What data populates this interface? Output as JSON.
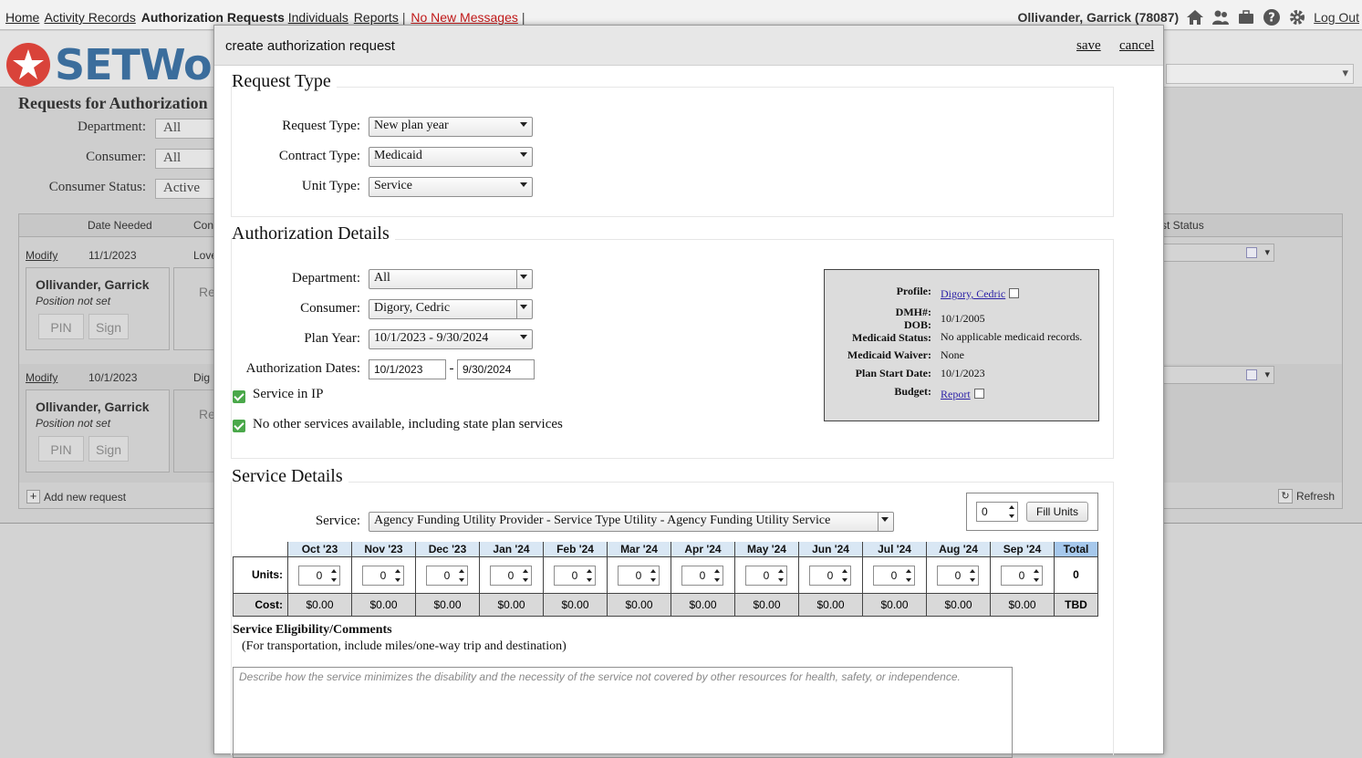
{
  "nav": {
    "links": [
      "Home",
      "Activity Records"
    ],
    "current": "Authorization Requests",
    "links2": [
      "Individuals",
      "Reports"
    ],
    "messages": "No New Messages",
    "user": "Ollivander, Garrick  (78087)",
    "logout": "Log Out"
  },
  "brand": "SETWork",
  "background": {
    "title": "Requests for Authorization",
    "filters": [
      {
        "label": "Department:",
        "value": "All"
      },
      {
        "label": "Consumer:",
        "value": "All"
      },
      {
        "label": "Consumer Status:",
        "value": "Active"
      }
    ],
    "columns": {
      "date_needed": "Date Needed",
      "con": "Con",
      "status": "st Status"
    },
    "rows": [
      {
        "link": "Modify",
        "date": "11/1/2023",
        "consumer": "Love",
        "name": "Ollivander, Garrick",
        "position": "Position not set",
        "pin": "PIN",
        "sign": "Sign",
        "re": "Re"
      },
      {
        "link": "Modify",
        "date": "10/1/2023",
        "consumer": "Dig",
        "name": "Ollivander, Garrick",
        "position": "Position not set",
        "pin": "PIN",
        "sign": "Sign",
        "re": "Re"
      }
    ],
    "add": "Add new request",
    "refresh": "Refresh"
  },
  "modal": {
    "title": "create authorization request",
    "save": "save",
    "cancel": "cancel",
    "request_type": {
      "heading": "Request Type",
      "fields": [
        {
          "label": "Request Type:",
          "value": "New plan year"
        },
        {
          "label": "Contract Type:",
          "value": "Medicaid"
        },
        {
          "label": "Unit Type:",
          "value": "Service"
        }
      ]
    },
    "auth_details": {
      "heading": "Authorization Details",
      "department": {
        "label": "Department:",
        "value": "All"
      },
      "consumer": {
        "label": "Consumer:",
        "value": "Digory, Cedric"
      },
      "plan_year": {
        "label": "Plan Year:",
        "value": "10/1/2023 - 9/30/2024"
      },
      "dates": {
        "label": "Authorization Dates:",
        "start": "10/1/2023",
        "sep": "-",
        "end": "9/30/2024"
      },
      "check1": "Service in IP",
      "check2": "No other services available, including state plan services",
      "info": {
        "profile_k": "Profile:",
        "profile_v": "Digory, Cedric",
        "dmh_k": "DMH#:",
        "dob_k": "DOB:",
        "dob_v": "10/1/2005",
        "medicaid_k": "Medicaid Status:",
        "medicaid_v": "No applicable medicaid records.",
        "waiver_k": "Medicaid Waiver:",
        "waiver_v": "None",
        "psd_k": "Plan Start Date:",
        "psd_v": "10/1/2023",
        "budget_k": "Budget:",
        "budget_v": "Report"
      }
    },
    "service_details": {
      "heading": "Service Details",
      "service_label": "Service:",
      "service_value": "Agency Funding Utility Provider - Service Type Utility - Agency Funding Utility Service",
      "fill_value": "0",
      "fill_button": "Fill Units",
      "units_label": "Units:",
      "cost_label": "Cost:",
      "months": [
        "Oct '23",
        "Nov '23",
        "Dec '23",
        "Jan '24",
        "Feb '24",
        "Mar '24",
        "Apr '24",
        "May '24",
        "Jun '24",
        "Jul '24",
        "Aug '24",
        "Sep '24"
      ],
      "total_label": "Total",
      "units": [
        "0",
        "0",
        "0",
        "0",
        "0",
        "0",
        "0",
        "0",
        "0",
        "0",
        "0",
        "0"
      ],
      "costs": [
        "$0.00",
        "$0.00",
        "$0.00",
        "$0.00",
        "$0.00",
        "$0.00",
        "$0.00",
        "$0.00",
        "$0.00",
        "$0.00",
        "$0.00",
        "$0.00"
      ],
      "units_total": "0",
      "cost_total": "TBD",
      "elig_title": "Service Eligibility/Comments",
      "elig_sub": "(For transportation, include miles/one-way trip and destination)",
      "comments_placeholder": "Describe how the service minimizes the disability and the necessity of the service not covered by other resources for health, safety, or independence."
    }
  }
}
